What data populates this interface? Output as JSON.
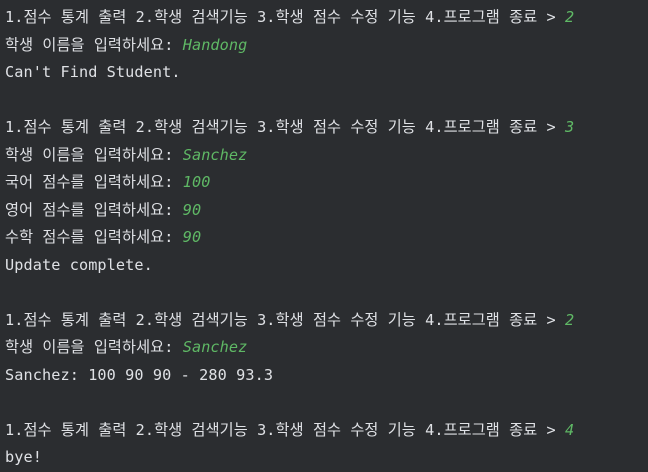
{
  "colors": {
    "background": "#2b2d30",
    "output_text": "#dfe1e5",
    "user_input": "#5fb865"
  },
  "lines": [
    {
      "type": "prompt",
      "text": "1.점수 통계 출력 2.학생 검색기능 3.학생 점수 수정 기능 4.프로그램 종료 > ",
      "input": "2"
    },
    {
      "type": "prompt",
      "text": "학생 이름을 입력하세요: ",
      "input": "Handong"
    },
    {
      "type": "output",
      "text": "Can't Find Student."
    },
    {
      "type": "blank"
    },
    {
      "type": "prompt",
      "text": "1.점수 통계 출력 2.학생 검색기능 3.학생 점수 수정 기능 4.프로그램 종료 > ",
      "input": "3"
    },
    {
      "type": "prompt",
      "text": "학생 이름을 입력하세요: ",
      "input": "Sanchez"
    },
    {
      "type": "prompt",
      "text": "국어 점수를 입력하세요: ",
      "input": "100"
    },
    {
      "type": "prompt",
      "text": "영어 점수를 입력하세요: ",
      "input": "90"
    },
    {
      "type": "prompt",
      "text": "수학 점수를 입력하세요: ",
      "input": "90"
    },
    {
      "type": "output",
      "text": "Update complete."
    },
    {
      "type": "blank"
    },
    {
      "type": "prompt",
      "text": "1.점수 통계 출력 2.학생 검색기능 3.학생 점수 수정 기능 4.프로그램 종료 > ",
      "input": "2"
    },
    {
      "type": "prompt",
      "text": "학생 이름을 입력하세요: ",
      "input": "Sanchez"
    },
    {
      "type": "output",
      "text": "Sanchez: 100 90 90 - 280 93.3"
    },
    {
      "type": "blank"
    },
    {
      "type": "prompt",
      "text": "1.점수 통계 출력 2.학생 검색기능 3.학생 점수 수정 기능 4.프로그램 종료 > ",
      "input": "4"
    },
    {
      "type": "output",
      "text": "bye!"
    }
  ]
}
